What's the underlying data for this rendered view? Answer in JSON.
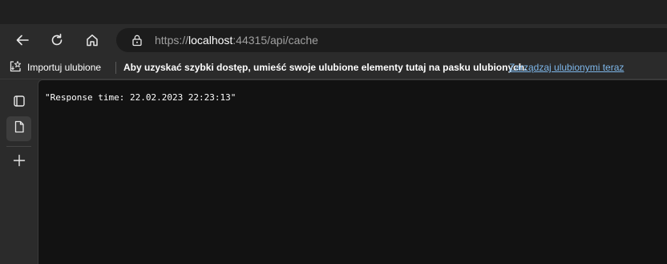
{
  "toolbar": {
    "back_icon": "back-arrow-icon",
    "refresh_icon": "refresh-icon",
    "home_icon": "home-icon"
  },
  "address": {
    "lock_icon": "lock-icon",
    "scheme": "https://",
    "host": "localhost",
    "rest": ":44315/api/cache"
  },
  "favorites": {
    "import_label": "Importuj ulubione",
    "message": "Aby uzyskać szybki dostęp, umieść swoje ulubione elementy tutaj na pasku ulubionych.",
    "manage_link": "Zarządzaj ulubionymi teraz"
  },
  "sidebar": {
    "items": [
      {
        "icon": "tab-actions-icon"
      },
      {
        "icon": "page-icon",
        "active": true
      },
      {
        "icon": "plus-icon"
      }
    ]
  },
  "page": {
    "body_text": "\"Response time: 22.02.2023 22:23:13\""
  },
  "colors": {
    "link": "#7eb7ea",
    "content_bg": "#121212",
    "chrome_bg": "#2b2b2b"
  }
}
